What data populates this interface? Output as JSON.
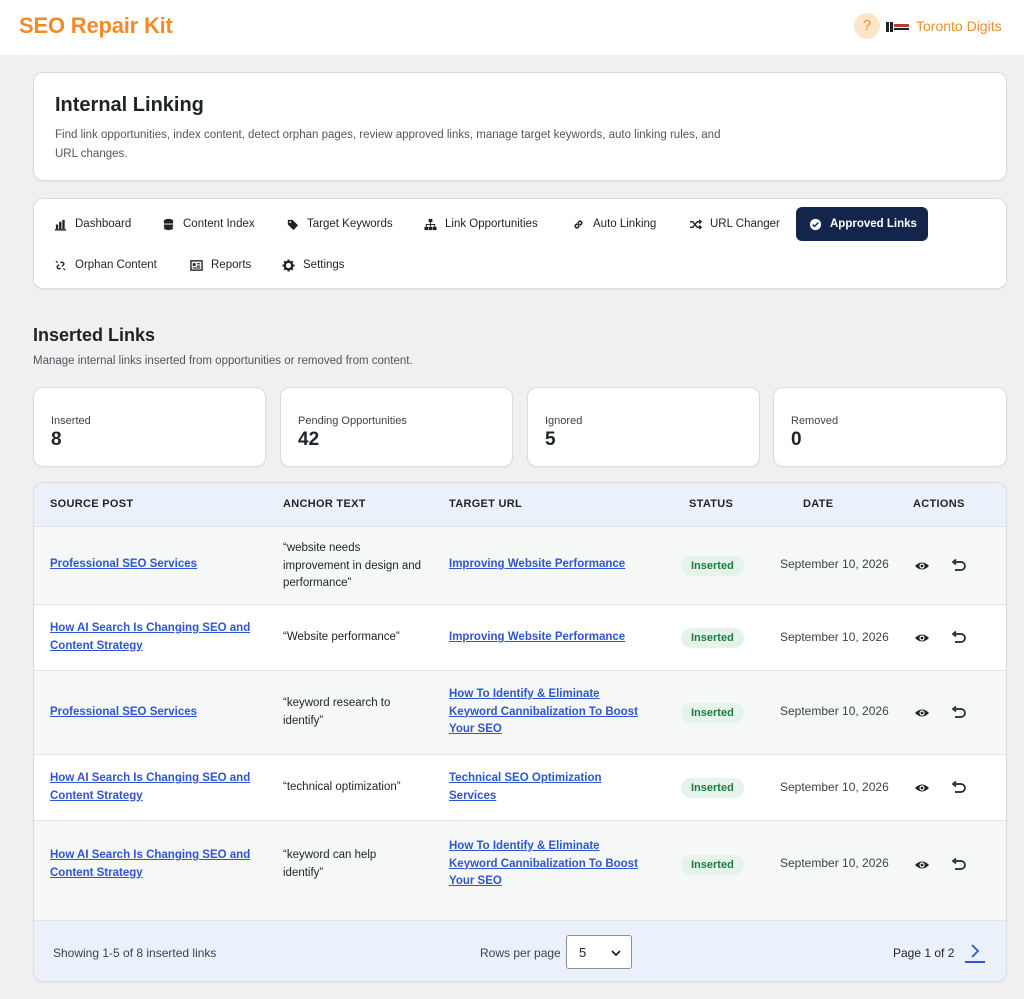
{
  "app": {
    "brand": "SEO Repair Kit",
    "help_icon": "question-icon",
    "help_label": "?",
    "site_name": "Toronto Digits",
    "accent": "#f28c28"
  },
  "intro": {
    "title": "Internal Linking",
    "description": "Find link opportunities, index content, detect orphan pages, review approved links, manage target keywords, auto linking rules, and URL changes."
  },
  "nav": {
    "tabs": [
      {
        "label": "Dashboard",
        "icon": "chart-bar-icon"
      },
      {
        "label": "Content Index",
        "icon": "database-icon"
      },
      {
        "label": "Target Keywords",
        "icon": "tag-icon"
      },
      {
        "label": "Link Opportunities",
        "icon": "sitemap-icon"
      },
      {
        "label": "Auto Linking",
        "icon": "link-icon"
      },
      {
        "label": "URL Changer",
        "icon": "shuffle-icon"
      },
      {
        "label": "Approved Links",
        "icon": "check-circle-icon",
        "active": true
      },
      {
        "label": "Orphan Content",
        "icon": "broken-link-icon"
      },
      {
        "label": "Reports",
        "icon": "report-icon"
      },
      {
        "label": "Settings",
        "icon": "gear-icon"
      }
    ],
    "active_color": "#13254a"
  },
  "section": {
    "title": "Inserted Links",
    "subtitle": "Manage internal links inserted from opportunities or removed from content."
  },
  "stats": [
    {
      "label": "Inserted",
      "value": "8"
    },
    {
      "label": "Pending Opportunities",
      "value": "42"
    },
    {
      "label": "Ignored",
      "value": "5"
    },
    {
      "label": "Removed",
      "value": "0"
    }
  ],
  "table": {
    "headers": {
      "source": "SOURCE POST",
      "anchor": "ANCHOR TEXT",
      "target": "TARGET URL",
      "status": "STATUS",
      "date": "DATE",
      "actions": "ACTIONS"
    },
    "rows": [
      {
        "source": "Professional SEO Services",
        "anchor": "“website needs improvement in design and performance”",
        "target": "Improving Website Performance",
        "status": "Inserted",
        "date": "September 10, 2026"
      },
      {
        "source": "How AI Search Is Changing SEO and Content Strategy",
        "anchor": "“Website performance”",
        "target": "Improving Website Performance",
        "status": "Inserted",
        "date": "September 10, 2026"
      },
      {
        "source": "Professional SEO Services",
        "anchor": "“keyword research to identify”",
        "target": "How To Identify & Eliminate Keyword Cannibalization To Boost Your SEO",
        "status": "Inserted",
        "date": "September 10, 2026"
      },
      {
        "source": "How AI Search Is Changing SEO and Content Strategy",
        "anchor": "“technical optimization”",
        "target": "Technical SEO Optimization Services",
        "status": "Inserted",
        "date": "September 10, 2026"
      },
      {
        "source": "How AI Search Is Changing SEO and Content Strategy",
        "anchor": "“keyword can help identify”",
        "target": "How To Identify & Eliminate Keyword Cannibalization To Boost Your SEO",
        "status": "Inserted",
        "date": "September 10, 2026"
      }
    ],
    "row_actions": [
      "eye-icon",
      "undo-icon"
    ],
    "status_color": "#1f7a43",
    "link_color": "#2f55d4"
  },
  "footer": {
    "showing": "Showing 1-5 of 8 inserted links",
    "rows_per_page_label": "Rows per page",
    "rows_per_page_value": "5",
    "page_info": "Page 1 of 2"
  }
}
